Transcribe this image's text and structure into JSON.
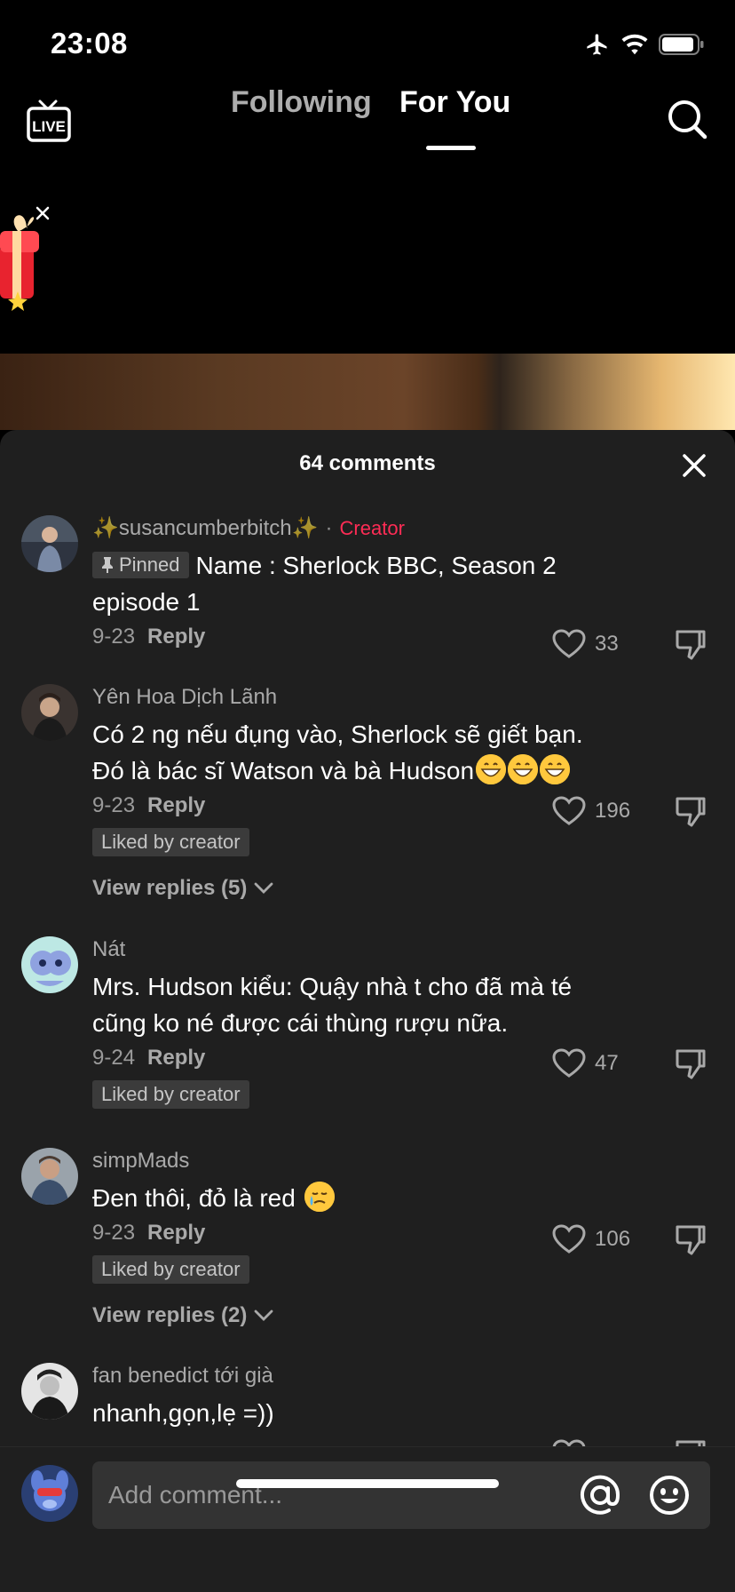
{
  "status_bar": {
    "time": "23:08"
  },
  "nav": {
    "live_label": "LIVE",
    "tabs": [
      {
        "label": "Following",
        "active": false
      },
      {
        "label": "For You",
        "active": true
      }
    ]
  },
  "sheet": {
    "title": "64 comments",
    "comments": [
      {
        "username": "✨susancumberbitch✨",
        "creator_label": "Creator",
        "pinned_label": "Pinned",
        "text": "Name : Sherlock BBC, Season 2 episode 1",
        "date": "9-23",
        "reply_label": "Reply",
        "likes": "33"
      },
      {
        "username": "Yên Hoa Dịch Lãnh",
        "text": "Có 2 ng nếu đụng vào, Sherlock sẽ giết bạn. Đó là bác sĩ Watson và bà Hudson",
        "date": "9-23",
        "reply_label": "Reply",
        "likes": "196",
        "liked_by": "Liked by creator",
        "view_replies": "View replies (5)"
      },
      {
        "username": "Nát",
        "text": "Mrs. Hudson kiểu: Quậy nhà t cho đã mà té cũng ko né được cái thùng rượu nữa.",
        "date": "9-24",
        "reply_label": "Reply",
        "likes": "47",
        "liked_by": "Liked by creator"
      },
      {
        "username": "simpMads",
        "text": "Đen thôi, đỏ là red",
        "date": "9-23",
        "reply_label": "Reply",
        "likes": "106",
        "liked_by": "Liked by creator",
        "view_replies": "View replies (2)"
      },
      {
        "username": "fan benedict tới già",
        "text": "nhanh,gọn,lẹ =))"
      }
    ]
  },
  "input": {
    "placeholder": "Add comment..."
  },
  "colors": {
    "accent": "#fe2c55",
    "sheet_bg": "#1f1f1f",
    "badge_bg": "#3b3b3b"
  },
  "icons": [
    "airplane-icon",
    "wifi-icon",
    "battery-icon",
    "live-icon",
    "search-icon",
    "close-icon",
    "pin-icon",
    "heart-icon",
    "dislike-icon",
    "chevron-down-icon",
    "at-icon",
    "emoji-icon",
    "grinning-emoji",
    "crying-emoji"
  ]
}
